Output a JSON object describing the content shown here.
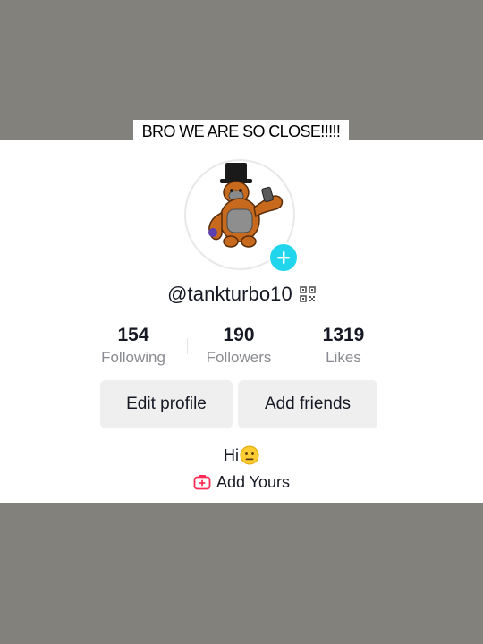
{
  "caption": {
    "text": "BRO WE ARE SO CLOSE!!!!!"
  },
  "profile": {
    "username": "@tankturbo10",
    "avatar_icon": "gorilla-top-hat-avatar",
    "add_badge_icon": "plus-icon",
    "qr_icon": "qr-code-icon"
  },
  "stats": [
    {
      "value": "154",
      "label": "Following"
    },
    {
      "value": "190",
      "label": "Followers"
    },
    {
      "value": "1319",
      "label": "Likes"
    }
  ],
  "buttons": {
    "edit_profile": "Edit profile",
    "add_friends": "Add friends"
  },
  "bio": {
    "text": "Hi",
    "emoji": "neutral-face-emoji"
  },
  "add_yours": {
    "label": "Add Yours",
    "icon": "add-yours-icon"
  },
  "colors": {
    "backdrop": "#82817c",
    "badge": "#20d5ec",
    "button_bg": "#efeff0",
    "muted_text": "#8a8b91",
    "accent_pink": "#fe2c55"
  }
}
